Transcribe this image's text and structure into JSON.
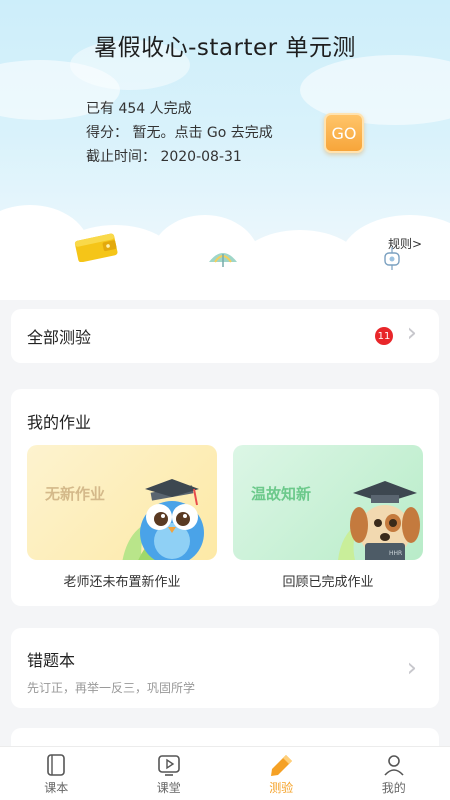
{
  "hero": {
    "title": "暑假收心-starter 单元测",
    "completed_text": "已有 454 人完成",
    "score_text": "得分： 暂无。点击 Go 去完成",
    "deadline_text": "截止时间： 2020-08-31",
    "go_label": "GO",
    "rules_label": "规则>"
  },
  "all_tests": {
    "label": "全部测验",
    "badge_count": "11"
  },
  "homework": {
    "title": "我的作业",
    "tiles": [
      {
        "label": "无新作业",
        "caption": "老师还未布置新作业"
      },
      {
        "label": "温故知新",
        "caption": "回顾已完成作业"
      }
    ]
  },
  "wrong_book": {
    "title": "错题本",
    "subtitle": "先订正，再举一反三，巩固所学"
  },
  "tabbar": {
    "active": "测验",
    "tabs": [
      {
        "label": "课本",
        "icon": "book-icon"
      },
      {
        "label": "课堂",
        "icon": "video-play-icon"
      },
      {
        "label": "测验",
        "icon": "pencil-icon"
      },
      {
        "label": "我的",
        "icon": "person-icon"
      }
    ]
  },
  "colors": {
    "accent": "#f5a125",
    "badge": "#e8262a",
    "hero_sky": "#cdeefa"
  }
}
